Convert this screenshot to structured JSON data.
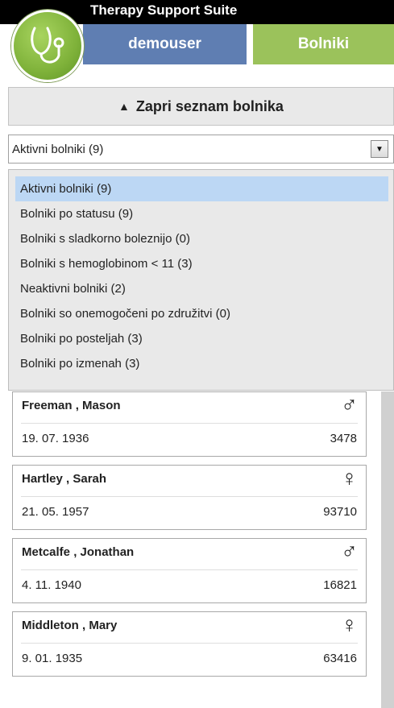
{
  "app": {
    "title": "Therapy Support Suite",
    "logo_icon": "stethoscope-icon"
  },
  "tabs": {
    "user": "demouser",
    "patients": "Bolniki"
  },
  "collapse_button": {
    "label": "Zapri seznam bolnika",
    "icon": "triangle-up-icon"
  },
  "filter": {
    "selected": "Aktivni bolniki (9)",
    "options": [
      "Aktivni bolniki (9)",
      "Bolniki po statusu (9)",
      "Bolniki s sladkorno boleznijo (0)",
      "Bolniki s hemoglobinom < 11 (3)",
      "Neaktivni bolniki (2)",
      "Bolniki so onemogočeni po združitvi (0)",
      "Bolniki po posteljah (3)",
      "Bolniki po izmenah (3)"
    ]
  },
  "patients": [
    {
      "name": "Freeman , Mason",
      "gender": "♂",
      "dob": "19. 07. 1936",
      "id": "3478"
    },
    {
      "name": "Hartley , Sarah",
      "gender": "♀",
      "dob": "21. 05. 1957",
      "id": "93710"
    },
    {
      "name": "Metcalfe , Jonathan",
      "gender": "♂",
      "dob": "4. 11. 1940",
      "id": "16821"
    },
    {
      "name": "Middleton , Mary",
      "gender": "♀",
      "dob": "9. 01. 1935",
      "id": "63416"
    }
  ],
  "colors": {
    "user_tab": "#5f7eb2",
    "patients_tab": "#9bc25b",
    "selected_option": "#bcd7f4"
  }
}
